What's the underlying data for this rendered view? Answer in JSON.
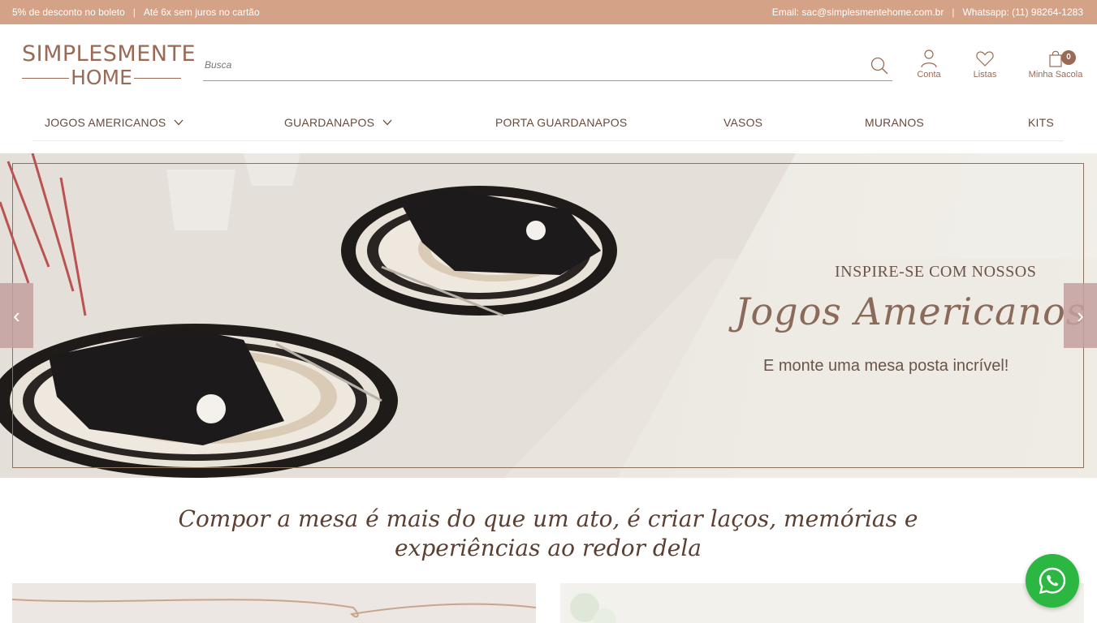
{
  "topbar": {
    "promo1": "5% de desconto no boleto",
    "sep": "|",
    "promo2": "Até 6x sem juros no cartão",
    "email": "Email: sac@simplesmentehome.com.br",
    "whatsapp": "Whatsapp: (11) 98264-1283"
  },
  "logo": {
    "line1": "SIMPLESMENTE",
    "line2": "HOME"
  },
  "search": {
    "placeholder": "Busca"
  },
  "header_icons": {
    "conta": "Conta",
    "listas": "Listas",
    "sacola": "Minha Sacola",
    "cart_count": "0"
  },
  "nav": {
    "items": [
      "JOGOS AMERICANOS",
      "GUARDANAPOS",
      "PORTA GUARDANAPOS",
      "VASOS",
      "MURANOS",
      "KITS"
    ]
  },
  "banner": {
    "line1": "INSPIRE-SE COM NOSSOS",
    "line2": "Jogos Americanos",
    "line3": "E monte uma mesa posta incrível!",
    "prev": "‹",
    "next": "›"
  },
  "tagline": {
    "line1": "Compor a mesa é mais do que um ato, é criar laços, memórias e",
    "line2": "experiências ao redor dela"
  },
  "colors": {
    "topbar": "#d4a387",
    "brand": "#9a6a55",
    "whatsapp": "#2bb741"
  }
}
